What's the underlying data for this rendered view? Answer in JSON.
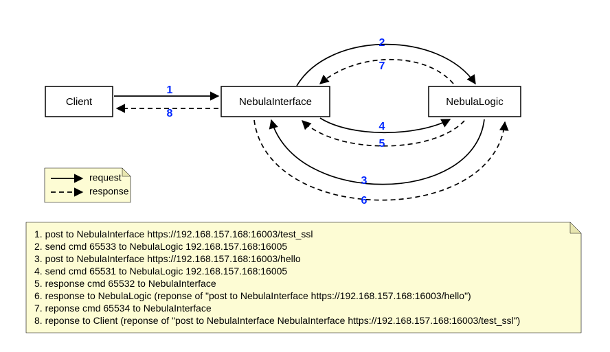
{
  "nodes": {
    "client": "Client",
    "interface": "NebulaInterface",
    "logic": "NebulaLogic"
  },
  "edge_labels": {
    "e1": "1",
    "e2": "2",
    "e3": "3",
    "e4": "4",
    "e5": "5",
    "e6": "6",
    "e7": "7",
    "e8": "8"
  },
  "legend": {
    "request": "request",
    "response": "response"
  },
  "steps": {
    "s1": "1. post to NebulaInterface https://192.168.157.168:16003/test_ssl",
    "s2": "2. send cmd 65533 to  NebulaLogic 192.168.157.168:16005",
    "s3": "3. post to NebulaInterface https://192.168.157.168:16003/hello",
    "s4": "4. send cmd 65531 to  NebulaLogic 192.168.157.168:16005",
    "s5": "5. response cmd 65532 to NebulaInterface",
    "s6": "6. response to NebulaLogic (reponse of \"post to NebulaInterface https://192.168.157.168:16003/hello\")",
    "s7": "7. reponse cmd 65534 to NebulaInterface",
    "s8": "8. reponse to Client (reponse of \"post to NebulaInterface NebulaInterface https://192.168.157.168:16003/test_ssl\")"
  }
}
